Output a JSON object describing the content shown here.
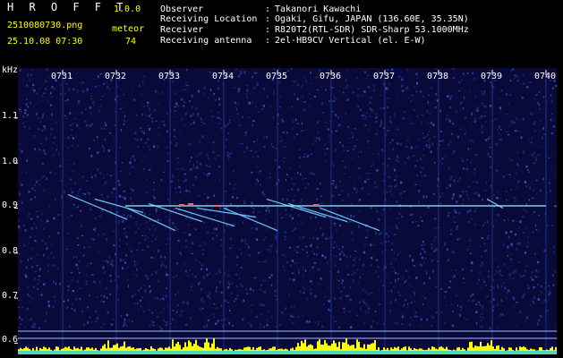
{
  "app": {
    "title": "H R O F F T",
    "version": "1.0.0"
  },
  "file": {
    "name": "2510080730.png",
    "datetime": "25.10.08 07:30"
  },
  "meteor": {
    "label": "meteor",
    "count": "74"
  },
  "info": [
    {
      "label": "Observer",
      "value": "Takanori Kawachi"
    },
    {
      "label": "Receiving Location",
      "value": "Ogaki, Gifu, JAPAN (136.60E, 35.35N)"
    },
    {
      "label": "Receiver",
      "value": "R820T2(RTL-SDR) SDR-Sharp 53.1000MHz"
    },
    {
      "label": "Receiving antenna",
      "value": "2el-HB9CV Vertical (el. E-W)"
    }
  ],
  "info_separator": ":",
  "colors": {
    "text": "#ffffff",
    "accent": "#ffff00",
    "background": "#000000",
    "carrier": "#a0f0ff"
  },
  "chart_data": {
    "type": "heatmap",
    "title": "",
    "xlabel": "",
    "ylabel": "kHz",
    "x_ticks": [
      "0731",
      "0732",
      "0733",
      "0734",
      "0735",
      "0736",
      "0737",
      "0738",
      "0739",
      "0740"
    ],
    "x_range_minutes": [
      0,
      10
    ],
    "x_tick_values": [
      1,
      2,
      3,
      4,
      5,
      6,
      7,
      8,
      9,
      10
    ],
    "y_ticks": [
      "1.1",
      "1.0",
      "0.9",
      "0.8",
      "0.7",
      "0.6"
    ],
    "y_tick_values": [
      1.1,
      1.0,
      0.9,
      0.8,
      0.7,
      0.6
    ],
    "ylim": [
      0.6,
      1.17
    ],
    "carrier": {
      "freq_khz": 0.905,
      "x_start": 1.0,
      "x_end": 10.0
    },
    "echo_streaks": [
      {
        "x1": 1.1,
        "y1": 0.93,
        "x2": 2.2,
        "y2": 0.875
      },
      {
        "x1": 1.6,
        "y1": 0.92,
        "x2": 2.5,
        "y2": 0.89
      },
      {
        "x1": 2.2,
        "y1": 0.9,
        "x2": 3.1,
        "y2": 0.85
      },
      {
        "x1": 2.6,
        "y1": 0.91,
        "x2": 3.6,
        "y2": 0.87
      },
      {
        "x1": 3.1,
        "y1": 0.9,
        "x2": 4.2,
        "y2": 0.86
      },
      {
        "x1": 3.5,
        "y1": 0.9,
        "x2": 4.6,
        "y2": 0.88
      },
      {
        "x1": 4.0,
        "y1": 0.9,
        "x2": 5.0,
        "y2": 0.85
      },
      {
        "x1": 4.8,
        "y1": 0.92,
        "x2": 5.9,
        "y2": 0.88
      },
      {
        "x1": 5.2,
        "y1": 0.91,
        "x2": 6.3,
        "y2": 0.87
      },
      {
        "x1": 5.8,
        "y1": 0.9,
        "x2": 6.9,
        "y2": 0.85
      },
      {
        "x1": 8.9,
        "y1": 0.92,
        "x2": 9.2,
        "y2": 0.9
      }
    ]
  }
}
